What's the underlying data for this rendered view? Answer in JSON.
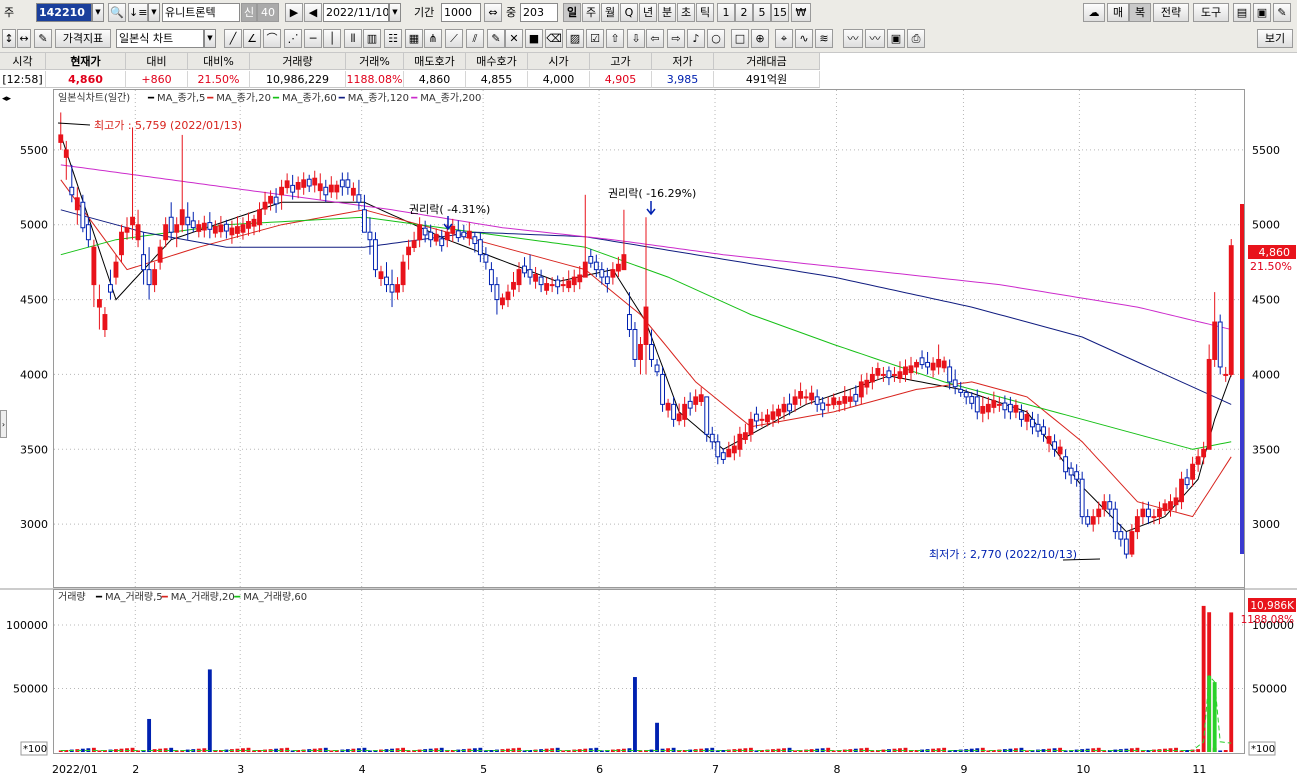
{
  "toolbar": {
    "type_label": "주",
    "code": "142210",
    "name": "유니트론텍",
    "badge1": "신",
    "badge2": "40",
    "date": "2022/11/10",
    "period_label": "기간",
    "period": "1000",
    "count_label": "중",
    "count": "203",
    "periods": [
      "일",
      "주",
      "월",
      "Q",
      "년",
      "분",
      "초",
      "틱",
      "1",
      "2",
      "5",
      "15",
      "₩"
    ],
    "selected_period": "일",
    "right_buttons": [
      "매",
      "복",
      "전략",
      "도구"
    ],
    "selected_right": "복"
  },
  "toolbar2": {
    "indicator_button": "가격지표",
    "chart_type": "일본식 차트",
    "view_button": "보기"
  },
  "quote": {
    "headers": [
      "시각",
      "현재가",
      "대비",
      "대비%",
      "거래량",
      "거래%",
      "매도호가",
      "매수호가",
      "시가",
      "고가",
      "저가",
      "거래대금"
    ],
    "values": [
      "[12:58]",
      "4,860",
      "+860",
      "21.50%",
      "10,986,229",
      "1188.08%",
      "4,860",
      "4,855",
      "4,000",
      "4,905",
      "3,985",
      "491억원"
    ]
  },
  "chart_labels": {
    "price_title": "일본식차트(일간)",
    "ma_price": [
      "MA_종가,5",
      "MA_종가,20",
      "MA_종가,60",
      "MA_종가,120",
      "MA_종가,200"
    ],
    "volume_title": "거래량",
    "ma_volume": [
      "MA_거래량,5",
      "MA_거래량,20",
      "MA_거래량,60"
    ],
    "high_annot": "최고가 : 5,759 (2022/01/13)",
    "low_annot": "최저가 : 2,770 (2022/10/13)",
    "rights1": "권리락( -4.31%)",
    "rights2": "권리락( -16.29%)",
    "price_tag": "4,860",
    "pct_tag": "21.50%",
    "vol_tag": "10,986K",
    "vol_pct_tag": "1188.08%",
    "vol_unit": "*100",
    "x_first": "2022/01"
  },
  "colors": {
    "up": "#e8131b",
    "down": "#0021b0",
    "ma5": "#000000",
    "ma20": "#d8241e",
    "ma60": "#16c016",
    "ma120": "#101c80",
    "ma200": "#cc2bcc",
    "vol_ma60": "#2ad12a"
  },
  "chart_data": {
    "type": "candlestick",
    "price_axis": {
      "ticks": [
        3000,
        3500,
        4000,
        4500,
        5000,
        5500
      ],
      "range": [
        2580,
        5880
      ]
    },
    "volume_axis": {
      "ticks": [
        50000,
        100000
      ],
      "range": [
        0,
        122000
      ],
      "unit": "*100"
    },
    "month_labels": [
      "2022/01",
      "2",
      "3",
      "4",
      "5",
      "6",
      "7",
      "8",
      "9",
      "10",
      "11"
    ],
    "month_starts": [
      0,
      14,
      33,
      55,
      77,
      98,
      119,
      141,
      164,
      185,
      206
    ],
    "anchors": [
      [
        0,
        5550,
        5750,
        5500,
        5600
      ],
      [
        1,
        5450,
        5560,
        5300,
        5500
      ],
      [
        2,
        5250,
        5400,
        5150,
        5200
      ],
      [
        3,
        5100,
        5250,
        5000,
        5180
      ],
      [
        4,
        5150,
        5200,
        4950,
        4980
      ],
      [
        5,
        5000,
        5050,
        4850,
        4900
      ],
      [
        6,
        4600,
        4900,
        4450,
        4850
      ],
      [
        7,
        4450,
        4600,
        4300,
        4500
      ],
      [
        8,
        4300,
        4450,
        4250,
        4400
      ],
      [
        9,
        4600,
        4700,
        4500,
        4550
      ],
      [
        10,
        4650,
        4800,
        4600,
        4750
      ],
      [
        11,
        4800,
        5000,
        4750,
        4950
      ],
      [
        12,
        4950,
        5050,
        4900,
        4980
      ],
      [
        13,
        5000,
        5650,
        4900,
        5050
      ],
      [
        14,
        4900,
        5100,
        4850,
        5000
      ],
      [
        15,
        4800,
        4950,
        4600,
        4700
      ],
      [
        16,
        4700,
        4850,
        4500,
        4600
      ],
      [
        17,
        4600,
        4750,
        4550,
        4700
      ],
      [
        18,
        4750,
        4900,
        4700,
        4850
      ],
      [
        19,
        4900,
        5050,
        4850,
        5000
      ],
      [
        20,
        5050,
        5150,
        4900,
        4950
      ],
      [
        21,
        4950,
        5050,
        4850,
        5000
      ],
      [
        22,
        5000,
        5600,
        4950,
        5100
      ],
      [
        23,
        5050,
        5150,
        4900,
        5000
      ],
      [
        33,
        4950,
        5050,
        4900,
        5000
      ],
      [
        36,
        5000,
        5150,
        4950,
        5100
      ],
      [
        40,
        5200,
        5300,
        5100,
        5250
      ],
      [
        44,
        5250,
        5350,
        5200,
        5300
      ],
      [
        48,
        5250,
        5300,
        5150,
        5200
      ],
      [
        52,
        5300,
        5350,
        5200,
        5250
      ],
      [
        54,
        5200,
        5300,
        5100,
        5150
      ],
      [
        55,
        5100,
        5200,
        4950,
        4950
      ],
      [
        56,
        4950,
        5050,
        4800,
        4900
      ],
      [
        57,
        4900,
        4950,
        4650,
        4700
      ],
      [
        59,
        4650,
        4750,
        4550,
        4600
      ],
      [
        60,
        4600,
        4700,
        4450,
        4550
      ],
      [
        61,
        4550,
        4650,
        4500,
        4600
      ],
      [
        62,
        4600,
        4800,
        4550,
        4750
      ],
      [
        63,
        4800,
        4900,
        4700,
        4850
      ],
      [
        65,
        4900,
        5050,
        4850,
        5000
      ],
      [
        67,
        4950,
        5000,
        4850,
        4900
      ],
      [
        70,
        4900,
        5000,
        4850,
        4950
      ],
      [
        73,
        4950,
        5000,
        4900,
        4920
      ],
      [
        76,
        4900,
        4950,
        4750,
        4800
      ],
      [
        77,
        4800,
        4850,
        4700,
        4750
      ],
      [
        78,
        4700,
        4750,
        4550,
        4600
      ],
      [
        79,
        4600,
        4650,
        4400,
        4500
      ],
      [
        81,
        4500,
        4600,
        4450,
        4550
      ],
      [
        83,
        4600,
        4750,
        4550,
        4700
      ],
      [
        85,
        4700,
        4800,
        4600,
        4650
      ],
      [
        87,
        4650,
        4700,
        4550,
        4600
      ],
      [
        89,
        4600,
        4650,
        4550,
        4600
      ],
      [
        91,
        4600,
        4650,
        4550,
        4600
      ],
      [
        93,
        4600,
        4700,
        4550,
        4650
      ],
      [
        95,
        4650,
        5200,
        4650,
        4750
      ],
      [
        97,
        4750,
        4800,
        4650,
        4700
      ],
      [
        98,
        4700,
        4750,
        4600,
        4650
      ],
      [
        100,
        4650,
        4750,
        4600,
        4700
      ],
      [
        102,
        4700,
        5100,
        4700,
        4800
      ],
      [
        103,
        4400,
        4550,
        4250,
        4300
      ],
      [
        104,
        4300,
        4350,
        4050,
        4100
      ],
      [
        105,
        4100,
        4250,
        4000,
        4200
      ],
      [
        106,
        4200,
        5050,
        4000,
        4450
      ],
      [
        107,
        4200,
        4300,
        4050,
        4100
      ],
      [
        109,
        4000,
        4050,
        3750,
        3800
      ],
      [
        111,
        3800,
        3850,
        3650,
        3700
      ],
      [
        113,
        3700,
        3850,
        3650,
        3800
      ],
      [
        115,
        3800,
        3900,
        3750,
        3850
      ],
      [
        117,
        3850,
        3850,
        3550,
        3600
      ],
      [
        118,
        3600,
        3650,
        3500,
        3550
      ],
      [
        119,
        3550,
        3600,
        3400,
        3450
      ],
      [
        121,
        3450,
        3550,
        3450,
        3500
      ],
      [
        123,
        3500,
        3650,
        3450,
        3600
      ],
      [
        125,
        3600,
        3750,
        3550,
        3700
      ],
      [
        127,
        3700,
        3750,
        3650,
        3700
      ],
      [
        129,
        3700,
        3800,
        3650,
        3750
      ],
      [
        131,
        3750,
        3850,
        3700,
        3800
      ],
      [
        133,
        3800,
        3900,
        3750,
        3850
      ],
      [
        135,
        3850,
        3900,
        3800,
        3850
      ],
      [
        137,
        3850,
        3900,
        3750,
        3800
      ],
      [
        139,
        3800,
        3850,
        3750,
        3800
      ],
      [
        141,
        3800,
        3850,
        3750,
        3820
      ],
      [
        143,
        3820,
        3900,
        3780,
        3850
      ],
      [
        145,
        3850,
        4000,
        3800,
        3950
      ],
      [
        147,
        3950,
        4050,
        3900,
        4000
      ],
      [
        149,
        4000,
        4050,
        3950,
        4000
      ],
      [
        151,
        4000,
        4050,
        3950,
        4000
      ],
      [
        153,
        4000,
        4100,
        3950,
        4050
      ],
      [
        155,
        4050,
        4100,
        4000,
        4080
      ],
      [
        157,
        4080,
        4150,
        4000,
        4050
      ],
      [
        159,
        4050,
        4200,
        4000,
        4100
      ],
      [
        161,
        4050,
        4100,
        3900,
        3950
      ],
      [
        163,
        3900,
        3950,
        3850,
        3880
      ],
      [
        164,
        3880,
        3900,
        3800,
        3850
      ],
      [
        166,
        3850,
        3900,
        3700,
        3750
      ],
      [
        168,
        3750,
        3850,
        3700,
        3800
      ],
      [
        170,
        3800,
        3850,
        3750,
        3800
      ],
      [
        172,
        3800,
        3850,
        3700,
        3750
      ],
      [
        174,
        3750,
        3800,
        3650,
        3700
      ],
      [
        176,
        3700,
        3750,
        3600,
        3650
      ],
      [
        178,
        3650,
        3700,
        3550,
        3600
      ],
      [
        180,
        3550,
        3600,
        3450,
        3500
      ],
      [
        182,
        3450,
        3500,
        3300,
        3350
      ],
      [
        184,
        3350,
        3400,
        3250,
        3300
      ],
      [
        185,
        3300,
        3350,
        3000,
        3050
      ],
      [
        186,
        3050,
        3100,
        2980,
        3000
      ],
      [
        187,
        3000,
        3100,
        2950,
        3050
      ],
      [
        188,
        3050,
        3150,
        3000,
        3100
      ],
      [
        189,
        3100,
        3200,
        3050,
        3150
      ],
      [
        190,
        3150,
        3200,
        3050,
        3100
      ],
      [
        191,
        3100,
        3150,
        2900,
        2950
      ],
      [
        192,
        2950,
        3000,
        2850,
        2900
      ],
      [
        193,
        2900,
        2950,
        2770,
        2800
      ],
      [
        194,
        2800,
        3000,
        2780,
        2950
      ],
      [
        195,
        2950,
        3100,
        2900,
        3050
      ],
      [
        196,
        3050,
        3150,
        3000,
        3100
      ],
      [
        197,
        3100,
        3150,
        3000,
        3050
      ],
      [
        198,
        3050,
        3100,
        3000,
        3050
      ],
      [
        199,
        3050,
        3150,
        3000,
        3100
      ],
      [
        201,
        3100,
        3200,
        3050,
        3150
      ],
      [
        203,
        3150,
        3350,
        3100,
        3300
      ],
      [
        205,
        3300,
        3450,
        3250,
        3400
      ],
      [
        206,
        3400,
        3500,
        3350,
        3450
      ],
      [
        207,
        3450,
        3550,
        3400,
        3500
      ],
      [
        208,
        3500,
        4200,
        3500,
        4100
      ],
      [
        209,
        4100,
        4550,
        4050,
        4350
      ],
      [
        210,
        4350,
        4400,
        4000,
        4050
      ],
      [
        211,
        4000,
        4050,
        3950,
        4000
      ],
      [
        212,
        4000,
        4905,
        3985,
        4860
      ]
    ],
    "ma": {
      "MA_종가,5": [
        [
          0,
          5600
        ],
        [
          10,
          4500
        ],
        [
          20,
          4900
        ],
        [
          40,
          5150
        ],
        [
          55,
          5150
        ],
        [
          70,
          4900
        ],
        [
          90,
          4620
        ],
        [
          100,
          4700
        ],
        [
          106,
          4350
        ],
        [
          112,
          3750
        ],
        [
          120,
          3500
        ],
        [
          135,
          3800
        ],
        [
          150,
          3990
        ],
        [
          163,
          3900
        ],
        [
          175,
          3750
        ],
        [
          185,
          3250
        ],
        [
          193,
          2950
        ],
        [
          200,
          3050
        ],
        [
          206,
          3300
        ],
        [
          209,
          3700
        ],
        [
          212,
          4000
        ]
      ],
      "MA_종가,20": [
        [
          0,
          5300
        ],
        [
          12,
          4700
        ],
        [
          25,
          4850
        ],
        [
          40,
          5000
        ],
        [
          55,
          5100
        ],
        [
          75,
          4900
        ],
        [
          95,
          4700
        ],
        [
          105,
          4400
        ],
        [
          115,
          3950
        ],
        [
          125,
          3650
        ],
        [
          140,
          3750
        ],
        [
          155,
          3900
        ],
        [
          165,
          3950
        ],
        [
          175,
          3850
        ],
        [
          185,
          3550
        ],
        [
          195,
          3150
        ],
        [
          205,
          3050
        ],
        [
          212,
          3450
        ]
      ],
      "MA_종가,60": [
        [
          0,
          4800
        ],
        [
          10,
          4900
        ],
        [
          30,
          5000
        ],
        [
          55,
          5050
        ],
        [
          75,
          4950
        ],
        [
          95,
          4850
        ],
        [
          110,
          4650
        ],
        [
          125,
          4400
        ],
        [
          140,
          4200
        ],
        [
          160,
          3950
        ],
        [
          175,
          3800
        ],
        [
          190,
          3650
        ],
        [
          205,
          3500
        ],
        [
          212,
          3550
        ]
      ],
      "MA_종가,120": [
        [
          0,
          5100
        ],
        [
          15,
          4950
        ],
        [
          30,
          4850
        ],
        [
          55,
          4850
        ],
        [
          75,
          4950
        ],
        [
          95,
          4920
        ],
        [
          115,
          4800
        ],
        [
          140,
          4650
        ],
        [
          165,
          4450
        ],
        [
          185,
          4250
        ],
        [
          200,
          4000
        ],
        [
          212,
          3800
        ]
      ],
      "MA_종가,200": [
        [
          0,
          5400
        ],
        [
          20,
          5300
        ],
        [
          40,
          5200
        ],
        [
          60,
          5100
        ],
        [
          80,
          4980
        ],
        [
          100,
          4900
        ],
        [
          120,
          4800
        ],
        [
          145,
          4700
        ],
        [
          170,
          4600
        ],
        [
          195,
          4450
        ],
        [
          212,
          4300
        ]
      ]
    },
    "volume_spikes": [
      [
        16,
        26000
      ],
      [
        27,
        65000
      ],
      [
        104,
        59000
      ],
      [
        108,
        23000
      ],
      [
        207,
        115000
      ],
      [
        208,
        110000
      ],
      [
        212,
        109862
      ]
    ],
    "volume_ma_green": [
      [
        0,
        1200
      ],
      [
        205,
        1200
      ],
      [
        207,
        8000
      ],
      [
        208,
        60000
      ],
      [
        209,
        55000
      ],
      [
        210,
        8000
      ],
      [
        212,
        7000
      ]
    ]
  }
}
